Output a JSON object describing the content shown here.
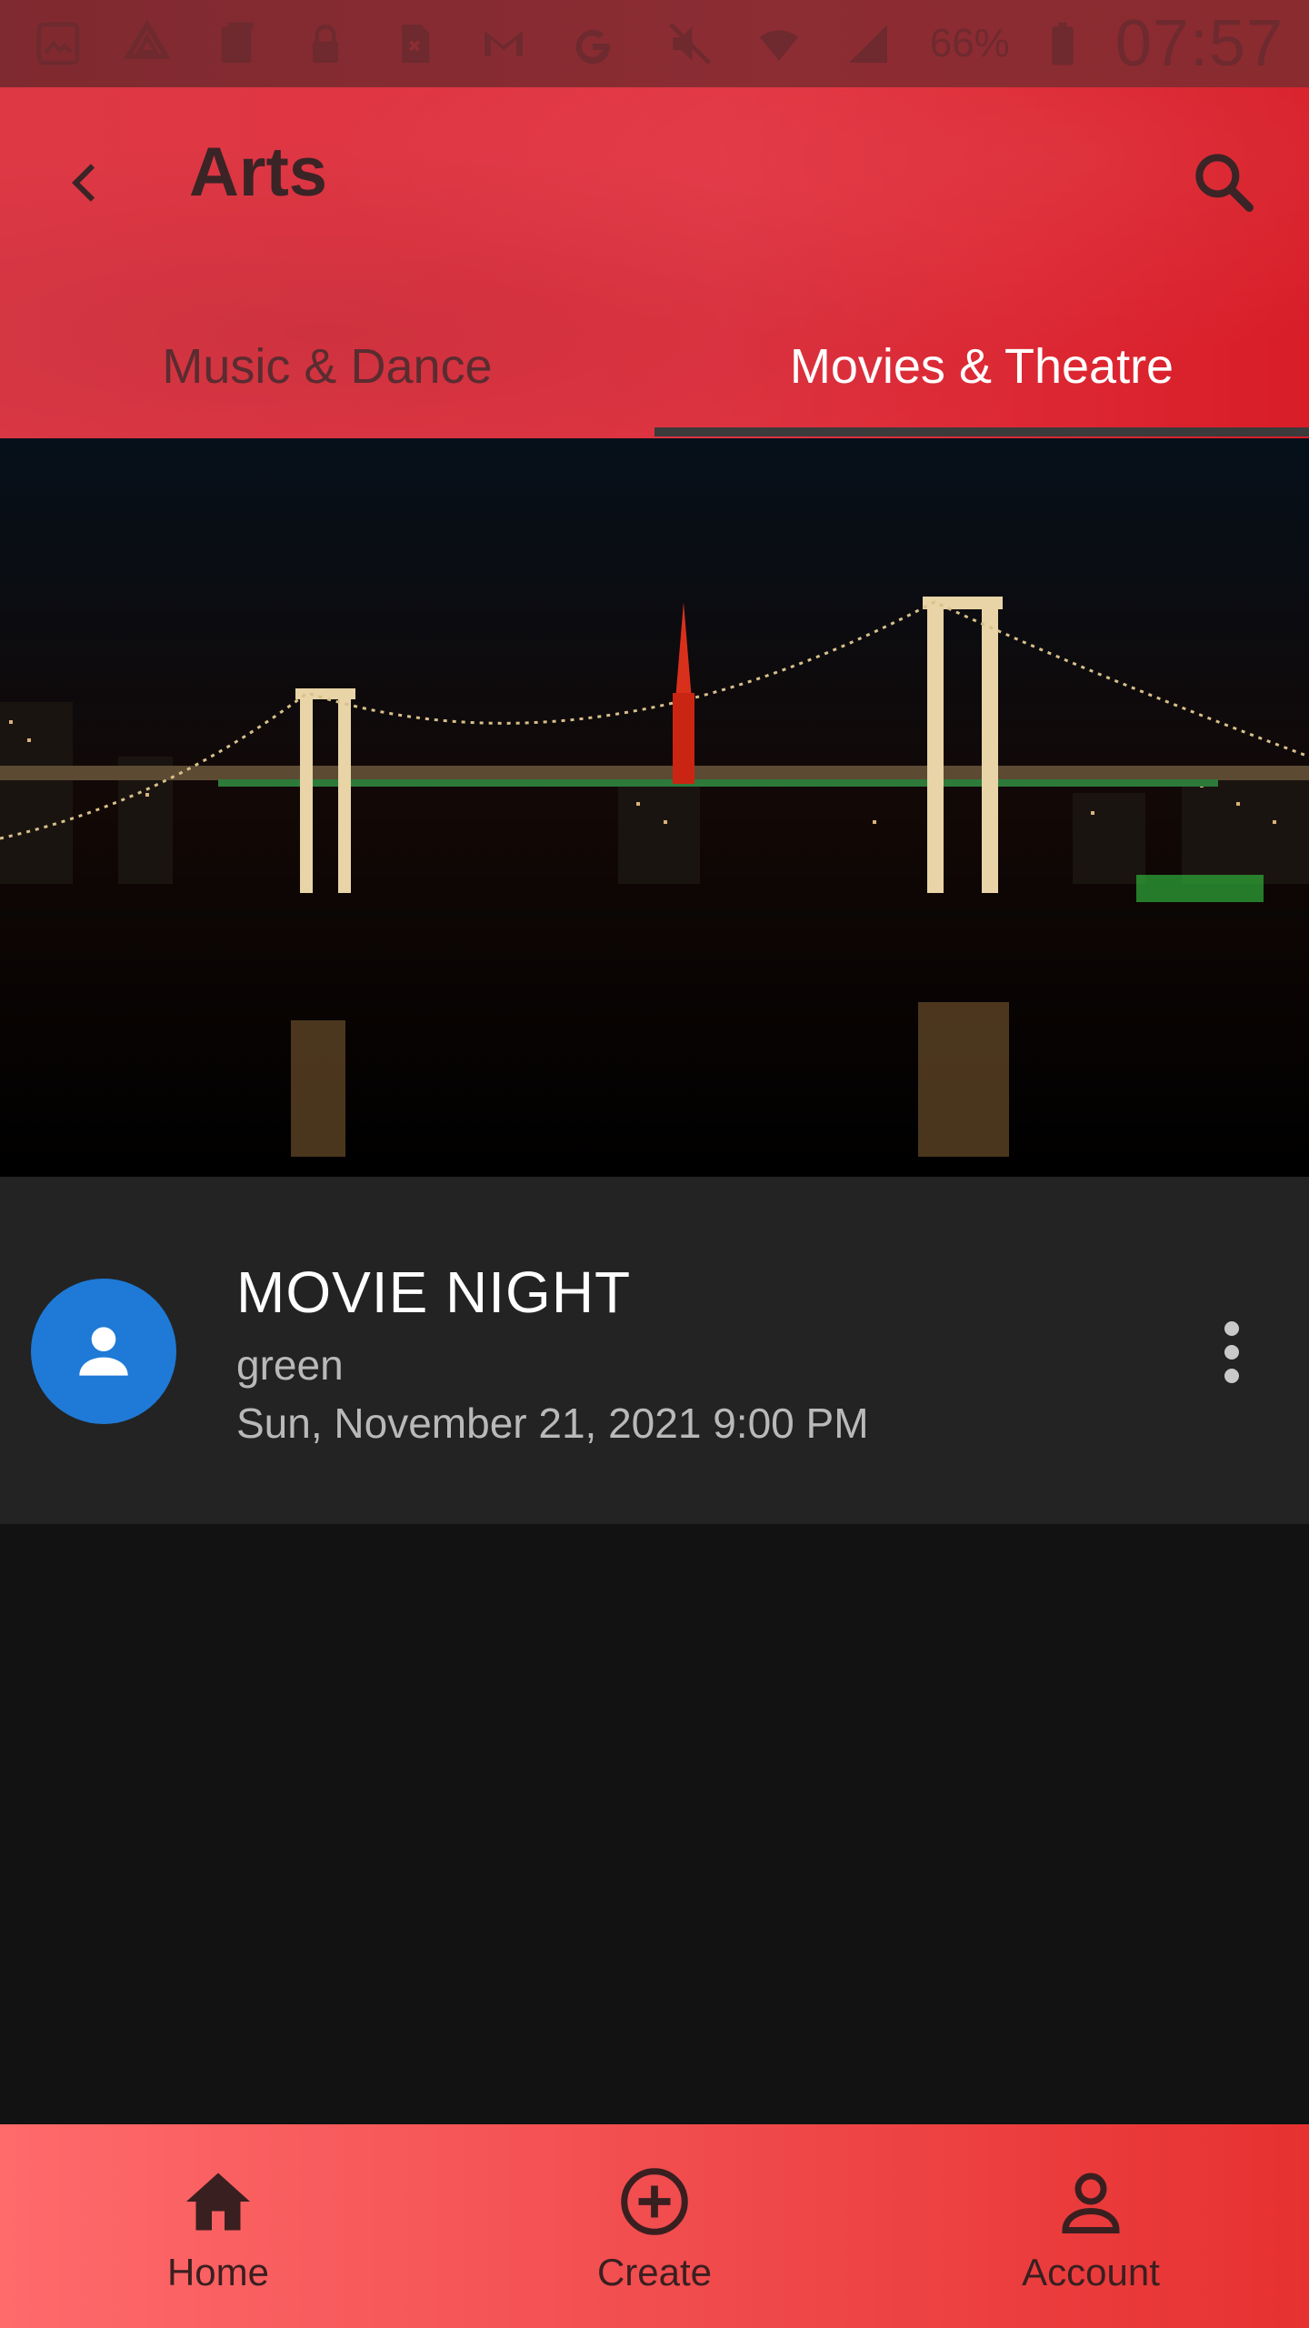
{
  "status_bar": {
    "battery_percent": "66%",
    "time": "07:57",
    "icons_left": [
      "photo-icon",
      "drive-icon",
      "copy-icon",
      "lock-icon",
      "sd-card-icon",
      "gmail-icon",
      "google-icon"
    ],
    "icons_right": [
      "mute-icon",
      "wifi-icon",
      "signal-icon",
      "battery-icon"
    ]
  },
  "app_bar": {
    "title": "Arts",
    "tabs": [
      {
        "label": "Music & Dance",
        "active": false
      },
      {
        "label": "Movies & Theatre",
        "active": true
      }
    ],
    "accent_color": "#e23442"
  },
  "hero": {
    "icon": "night-bridge-image"
  },
  "event": {
    "title": "MOVIE NIGHT",
    "organizer": "green",
    "datetime": "Sun, November 21, 2021 9:00 PM",
    "avatar_color": "#1e7ad6"
  },
  "bottom_nav": {
    "items": [
      {
        "label": "Home",
        "icon": "home-icon"
      },
      {
        "label": "Create",
        "icon": "add-circle-icon"
      },
      {
        "label": "Account",
        "icon": "account-icon"
      }
    ]
  }
}
